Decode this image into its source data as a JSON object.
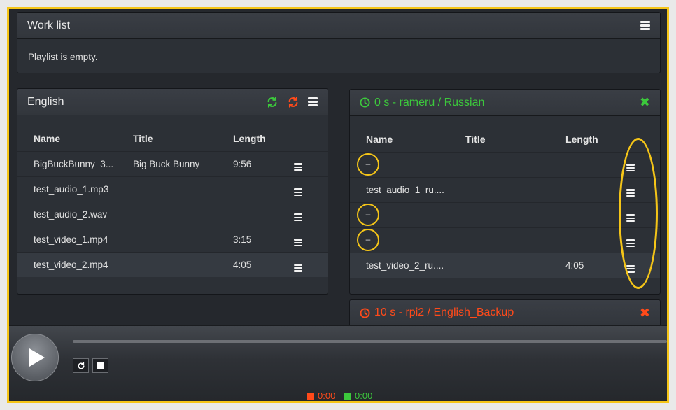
{
  "worklist": {
    "title": "Work list",
    "empty_text": "Playlist is empty."
  },
  "english": {
    "title": "English",
    "columns": [
      "Name",
      "Title",
      "Length"
    ],
    "rows": [
      {
        "name": "BigBuckBunny_3...",
        "title": "Big Buck Bunny",
        "length": "9:56"
      },
      {
        "name": "test_audio_1.mp3",
        "title": "",
        "length": ""
      },
      {
        "name": "test_audio_2.wav",
        "title": "",
        "length": ""
      },
      {
        "name": "test_video_1.mp4",
        "title": "",
        "length": "3:15"
      },
      {
        "name": "test_video_2.mp4",
        "title": "",
        "length": "4:05"
      }
    ]
  },
  "russian": {
    "title": "0 s - rameru / Russian",
    "columns": [
      "Name",
      "Title",
      "Length"
    ],
    "rows": [
      {
        "name": "–",
        "title": "",
        "length": ""
      },
      {
        "name": "test_audio_1_ru....",
        "title": "",
        "length": ""
      },
      {
        "name": "–",
        "title": "",
        "length": ""
      },
      {
        "name": "–",
        "title": "",
        "length": ""
      },
      {
        "name": "test_video_2_ru....",
        "title": "",
        "length": "4:05"
      }
    ]
  },
  "backup": {
    "title": "10 s - rpi2 / English_Backup"
  },
  "player": {
    "red_time": "0:00",
    "green_time": "0:00"
  },
  "colors": {
    "green": "#3cc83c",
    "red": "#ff4a1a",
    "highlight": "#f5c518"
  },
  "icons": [
    "menu-icon",
    "refresh-icon",
    "clock-icon",
    "close-icon",
    "play-icon",
    "reload-icon",
    "stop-icon"
  ]
}
